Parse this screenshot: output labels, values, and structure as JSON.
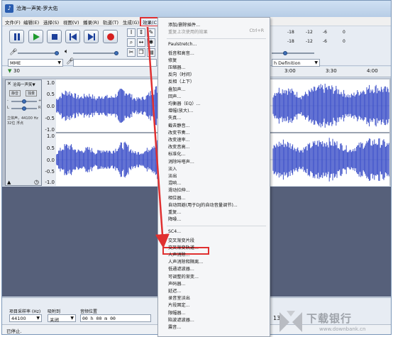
{
  "window": {
    "title": "沧海一声笑-罗大佑"
  },
  "menubar": [
    {
      "label": "文件(F)"
    },
    {
      "label": "编辑(E)"
    },
    {
      "label": "选择(S)"
    },
    {
      "label": "视图(V)"
    },
    {
      "label": "播录(R)"
    },
    {
      "label": "轨道(T)"
    },
    {
      "label": "生成(G)"
    },
    {
      "label": "效果(C)",
      "active": true
    }
  ],
  "device": {
    "host": "MME",
    "output_partial": "h Definition"
  },
  "meter_ticks": [
    "-18",
    "-12",
    "-6",
    "0"
  ],
  "ruler": {
    "ticks": [
      "30",
      "1:00",
      "1:30",
      "2:00",
      "2:30",
      "3:00",
      "3:30",
      "4:00"
    ],
    "visible_left": "30",
    "visible_right": [
      "3:00",
      "3:30",
      "4:00"
    ]
  },
  "track": {
    "name": "沧海一声笑▼",
    "mute": "静音",
    "solo": "独奏",
    "info": "立体声，44100 Hz",
    "format": "32位 浮点",
    "gain_left": "-",
    "gain_right": "+",
    "pan_left": "L",
    "pan_right": "R",
    "scale": [
      "1.0",
      "0.5",
      "0.0",
      "-0.5",
      "-1.0"
    ]
  },
  "selection_bar": {
    "rate_label": "项目采样率 (Hz)",
    "rate_value": "44100",
    "snap_label": "吸附到",
    "snap_value": "关闭",
    "pos_label": "音频位置",
    "pos_value": "00 h 00 m 00",
    "right_partial": "13"
  },
  "status": {
    "text": "已停止."
  },
  "effect_menu": {
    "items": [
      {
        "label": "添加/删除插件...",
        "disabled": false
      },
      {
        "label": "重复上次使用的效果",
        "shortcut": "Ctrl+R",
        "disabled": true
      },
      {
        "sep": true
      },
      {
        "label": "Paulstretch..."
      },
      {
        "label": "低音和高音..."
      },
      {
        "label": "修复"
      },
      {
        "label": "压缩器..."
      },
      {
        "label": "反向（时间）"
      },
      {
        "label": "反相（上下）"
      },
      {
        "label": "叠加声..."
      },
      {
        "label": "回声..."
      },
      {
        "label": "均衡器（EQ）..."
      },
      {
        "label": "增幅(放大)..."
      },
      {
        "label": "失真..."
      },
      {
        "label": "截去静音..."
      },
      {
        "label": "改变节奏..."
      },
      {
        "label": "改变速率..."
      },
      {
        "label": "改变音高..."
      },
      {
        "label": "标准化..."
      },
      {
        "label": "消除咔嗒声..."
      },
      {
        "label": "淡入"
      },
      {
        "label": "淡出"
      },
      {
        "label": "混响..."
      },
      {
        "label": "滑动拉伸..."
      },
      {
        "label": "相位器..."
      },
      {
        "label": "自动回避(用于DJ的自动音量调节)..."
      },
      {
        "label": "重复..."
      },
      {
        "label": "降噪..."
      },
      {
        "sep": true
      },
      {
        "label": "SC4..."
      },
      {
        "label": "交叉渐变片段"
      },
      {
        "label": "交叉渐变轨道..."
      },
      {
        "label": "人声消除...",
        "highlight": true
      },
      {
        "label": "人声消除和隔离..."
      },
      {
        "label": "低通滤波器..."
      },
      {
        "label": "可调整的渐变..."
      },
      {
        "label": "声码器..."
      },
      {
        "label": "延迟..."
      },
      {
        "label": "录音室淡出"
      },
      {
        "label": "片段固定..."
      },
      {
        "label": "限幅器..."
      },
      {
        "label": "陷波滤波器..."
      },
      {
        "label": "震音..."
      }
    ]
  },
  "watermark": {
    "text": "下载银行",
    "url": "www.downbank.cn"
  },
  "colors": {
    "wave": "#3b4fc8",
    "highlight": "#e03030",
    "empty_area": "#56607a"
  }
}
